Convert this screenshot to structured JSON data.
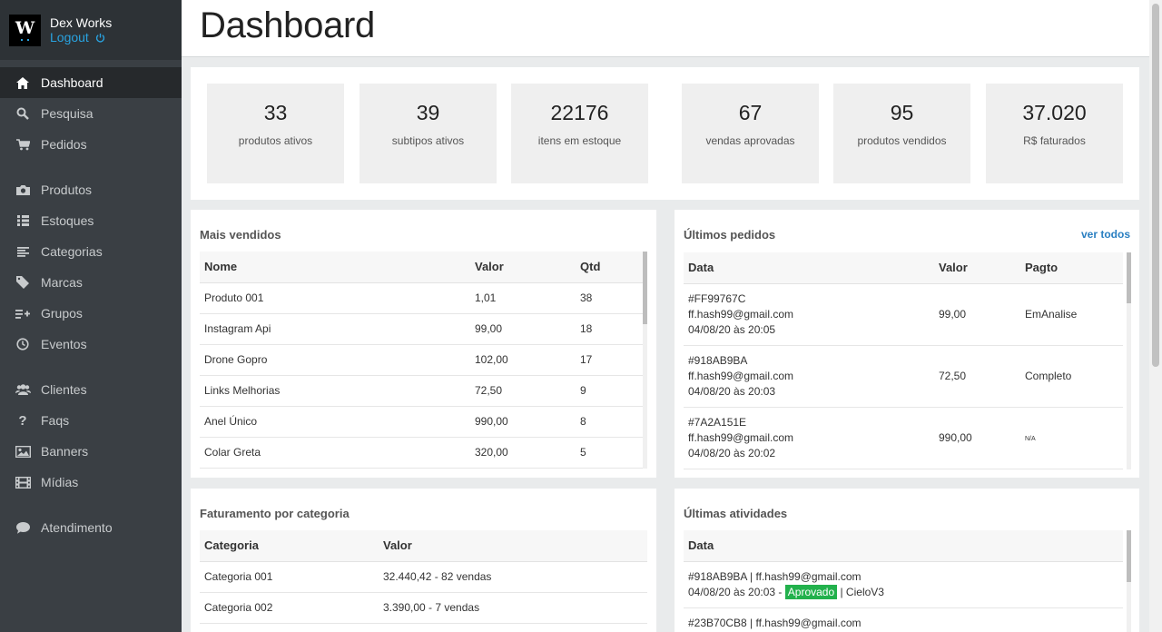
{
  "brand": {
    "logo_letter": "W",
    "user_name": "Dex Works",
    "logout_label": "Logout"
  },
  "page_title": "Dashboard",
  "nav": [
    {
      "label": "Dashboard",
      "icon": "home-icon"
    },
    {
      "label": "Pesquisa",
      "icon": "search-icon"
    },
    {
      "label": "Pedidos",
      "icon": "cart-icon"
    },
    {
      "label": "Produtos",
      "icon": "camera-icon"
    },
    {
      "label": "Estoques",
      "icon": "grid-icon"
    },
    {
      "label": "Categorias",
      "icon": "list-icon"
    },
    {
      "label": "Marcas",
      "icon": "tag-icon"
    },
    {
      "label": "Grupos",
      "icon": "add-list-icon"
    },
    {
      "label": "Eventos",
      "icon": "clock-icon"
    },
    {
      "label": "Clientes",
      "icon": "users-icon"
    },
    {
      "label": "Faqs",
      "icon": "question-icon"
    },
    {
      "label": "Banners",
      "icon": "image-icon"
    },
    {
      "label": "Mídias",
      "icon": "film-icon"
    },
    {
      "label": "Atendimento",
      "icon": "chat-icon"
    }
  ],
  "stats": [
    {
      "value": "33",
      "label": "produtos ativos"
    },
    {
      "value": "39",
      "label": "subtipos ativos"
    },
    {
      "value": "22176",
      "label": "itens em estoque"
    },
    {
      "value": "67",
      "label": "vendas aprovadas"
    },
    {
      "value": "95",
      "label": "produtos vendidos"
    },
    {
      "value": "37.020",
      "label": "R$ faturados"
    }
  ],
  "mais_vendidos": {
    "title": "Mais vendidos",
    "headers": [
      "Nome",
      "Valor",
      "Qtd"
    ],
    "rows": [
      [
        "Produto 001",
        "1,01",
        "38"
      ],
      [
        "Instagram Api",
        "99,00",
        "18"
      ],
      [
        "Drone Gopro",
        "102,00",
        "17"
      ],
      [
        "Links Melhorias",
        "72,50",
        "9"
      ],
      [
        "Anel Único",
        "990,00",
        "8"
      ],
      [
        "Colar Greta",
        "320,00",
        "5"
      ]
    ]
  },
  "ultimos_pedidos": {
    "title": "Últimos pedidos",
    "link": "ver todos",
    "headers": [
      "Data",
      "Valor",
      "Pagto"
    ],
    "rows": [
      {
        "id": "#FF99767C",
        "email": "ff.hash99@gmail.com",
        "date": "04/08/20 às 20:05",
        "valor": "99,00",
        "pagto": "EmAnalise"
      },
      {
        "id": "#918AB9BA",
        "email": "ff.hash99@gmail.com",
        "date": "04/08/20 às 20:03",
        "valor": "72,50",
        "pagto": "Completo"
      },
      {
        "id": "#7A2A151E",
        "email": "ff.hash99@gmail.com",
        "date": "04/08/20 às 20:02",
        "valor": "990,00",
        "pagto": "N/A"
      }
    ]
  },
  "faturamento": {
    "title": "Faturamento por categoria",
    "headers": [
      "Categoria",
      "Valor"
    ],
    "rows": [
      [
        "Categoria 001",
        "32.440,42 - 82 vendas"
      ],
      [
        "Categoria 002",
        "3.390,00 - 7 vendas"
      ]
    ]
  },
  "atividades": {
    "title": "Últimas atividades",
    "headers": [
      "Data"
    ],
    "rows": [
      {
        "line1": "#918AB9BA | ff.hash99@gmail.com",
        "date": "04/08/20 às 20:03 -",
        "status": "Aprovado",
        "tail": "| CieloV3"
      },
      {
        "line1": "#23B70CB8 | ff.hash99@gmail.com"
      }
    ]
  }
}
